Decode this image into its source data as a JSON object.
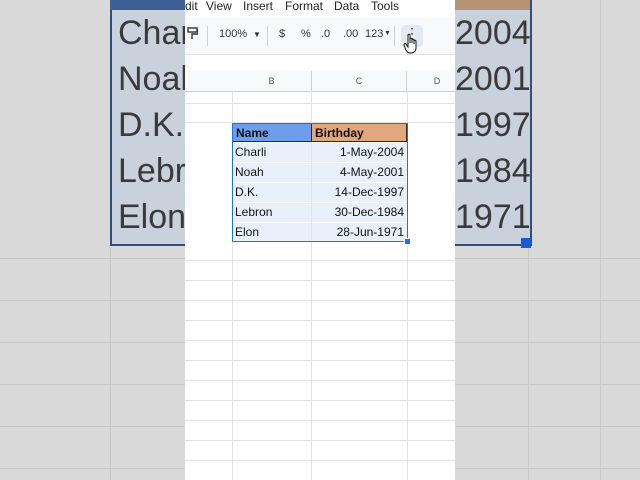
{
  "menu": {
    "items": [
      "dit",
      "View",
      "Insert",
      "Format",
      "Data",
      "Tools"
    ]
  },
  "toolbar": {
    "zoom": "100%",
    "currency": "$",
    "percent": "%",
    "decrease_decimal": ".0",
    "increase_decimal": ".00",
    "number_format": "123",
    "more": "⋮"
  },
  "columns": [
    "B",
    "C",
    "D"
  ],
  "table": {
    "headers": [
      "Name",
      "Birthday"
    ],
    "rows": [
      [
        "Charli",
        "1-May-2004"
      ],
      [
        "Noah",
        "4-May-2001"
      ],
      [
        "D.K.",
        "14-Dec-1997"
      ],
      [
        "Lebron",
        "30-Dec-1984"
      ],
      [
        "Elon",
        "28-Jun-1971"
      ]
    ]
  },
  "background_zoom": {
    "names": [
      "Charl",
      "Noah",
      "D.K.",
      "Lebro",
      "Elon"
    ],
    "years": [
      "2004",
      "2001",
      "1997",
      "1984",
      "1971"
    ]
  },
  "colors": {
    "name_header": "#6d9eeb",
    "birthday_header": "#e2a77c",
    "selection": "#1a73e8",
    "selected_fill": "#e8f0fb"
  }
}
